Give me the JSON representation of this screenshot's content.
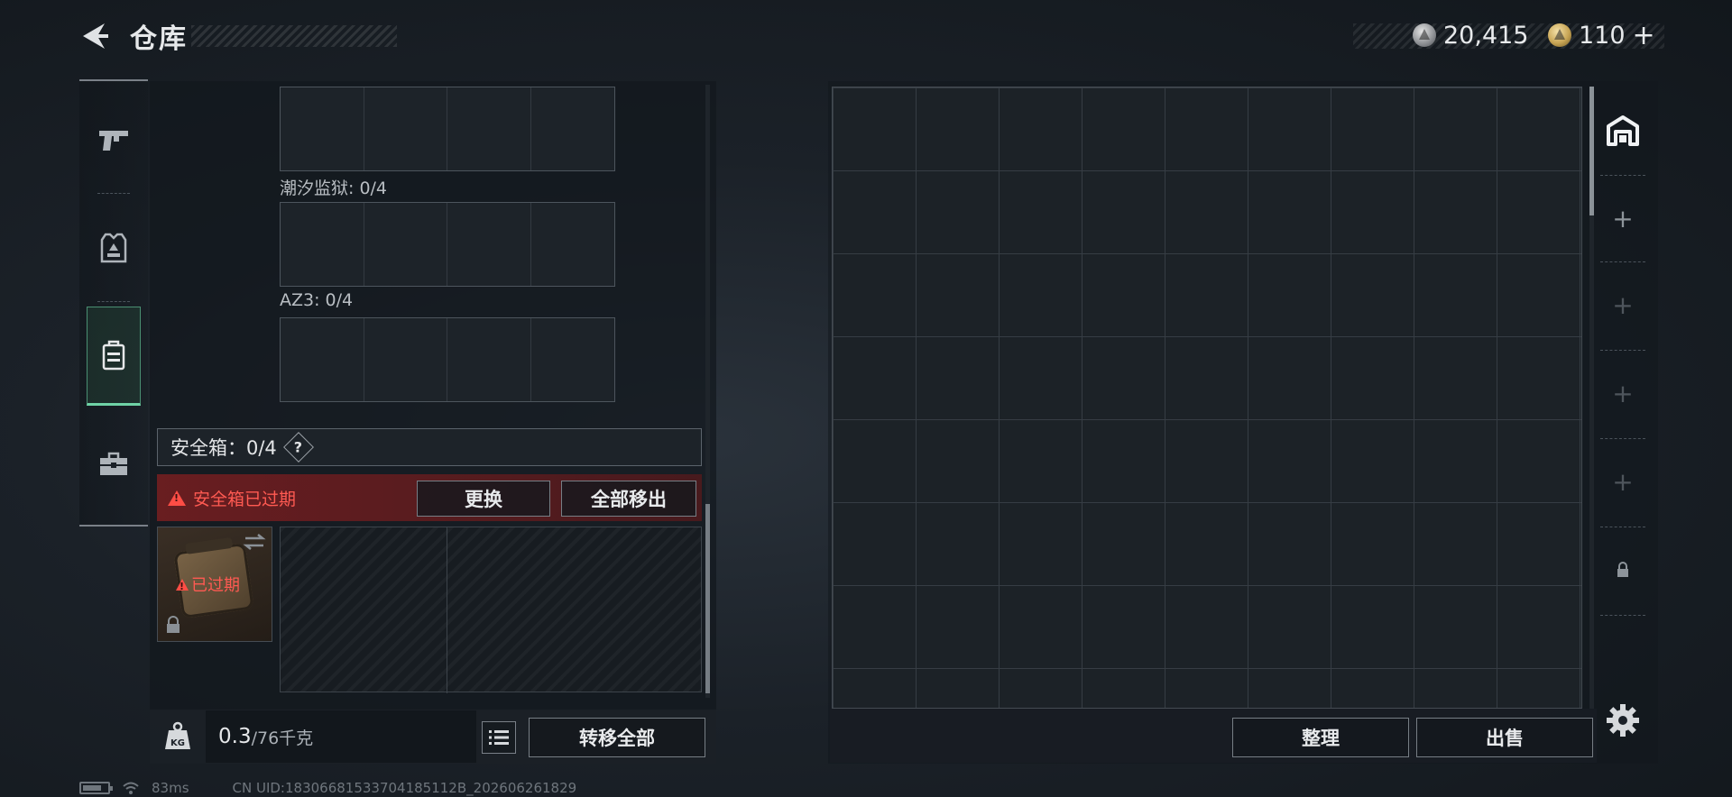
{
  "header": {
    "title": "仓库",
    "back_icon": "back-arrow-icon",
    "currencies": [
      {
        "icon": "silver-coin-icon",
        "value": "20,415",
        "color": "#a7aaae"
      },
      {
        "icon": "gold-coin-icon",
        "value": "110",
        "add_label": "+",
        "color": "#c8a555"
      }
    ]
  },
  "left_tabs": [
    {
      "icon": "pistol-icon",
      "active": false
    },
    {
      "icon": "armor-vest-icon",
      "active": false
    },
    {
      "icon": "backpack-icon",
      "active": true
    },
    {
      "icon": "toolbox-icon",
      "active": false
    }
  ],
  "slots": [
    {
      "label": "潮汐监狱: 0/4"
    },
    {
      "label": "AZ3: 0/4"
    }
  ],
  "safe_box": {
    "label": "安全箱：0/4",
    "help_label": "?",
    "expired_notice": "安全箱已过期",
    "replace_label": "更换",
    "remove_all_label": "全部移出",
    "case_status": "已过期"
  },
  "footer_left": {
    "weight_value": "0.3",
    "weight_max": "/76千克",
    "transfer_all_label": "转移全部"
  },
  "footer_right": {
    "sort_label": "整理",
    "sell_label": "出售"
  },
  "status_bar": {
    "ping": "83ms",
    "uid": "CN UID:18306681533704185112B_202606261829"
  },
  "colors": {
    "accent_green": "#6fd3a6",
    "warning_red": "#ff5a52"
  }
}
